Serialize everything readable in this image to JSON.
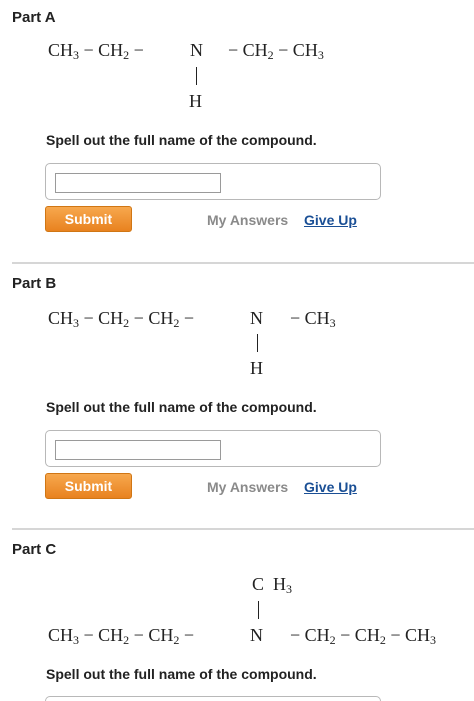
{
  "parts": [
    {
      "title": "Part A",
      "prompt": "Spell out the full name of the compound.",
      "input_value": "",
      "submit_label": "Submit",
      "my_answers_label": "My Answers",
      "give_up_label": "Give Up"
    },
    {
      "title": "Part B",
      "prompt": "Spell out the full name of the compound.",
      "input_value": "",
      "submit_label": "Submit",
      "my_answers_label": "My Answers",
      "give_up_label": "Give Up"
    },
    {
      "title": "Part C",
      "prompt": "Spell out the full name of the compound."
    }
  ],
  "formulas": {
    "a": {
      "left_chain": "CH3 − CH2 −",
      "center": "N",
      "right_chain": "− CH2 − CH3",
      "substituent": "H"
    },
    "b": {
      "left_chain": "CH3 − CH2 − CH2 −",
      "center": "N",
      "right_chain": "− CH3",
      "substituent": "H"
    },
    "c": {
      "left_chain": "CH3 − CH2 − CH2 −",
      "center": "N",
      "right_chain": "− CH2 − CH2 − CH3",
      "substituent": "C H3"
    }
  },
  "colors": {
    "submit_bg": "#f0952f",
    "link": "#1a4f95",
    "muted_link": "#8a8a8a",
    "divider": "#d6d6d6"
  }
}
